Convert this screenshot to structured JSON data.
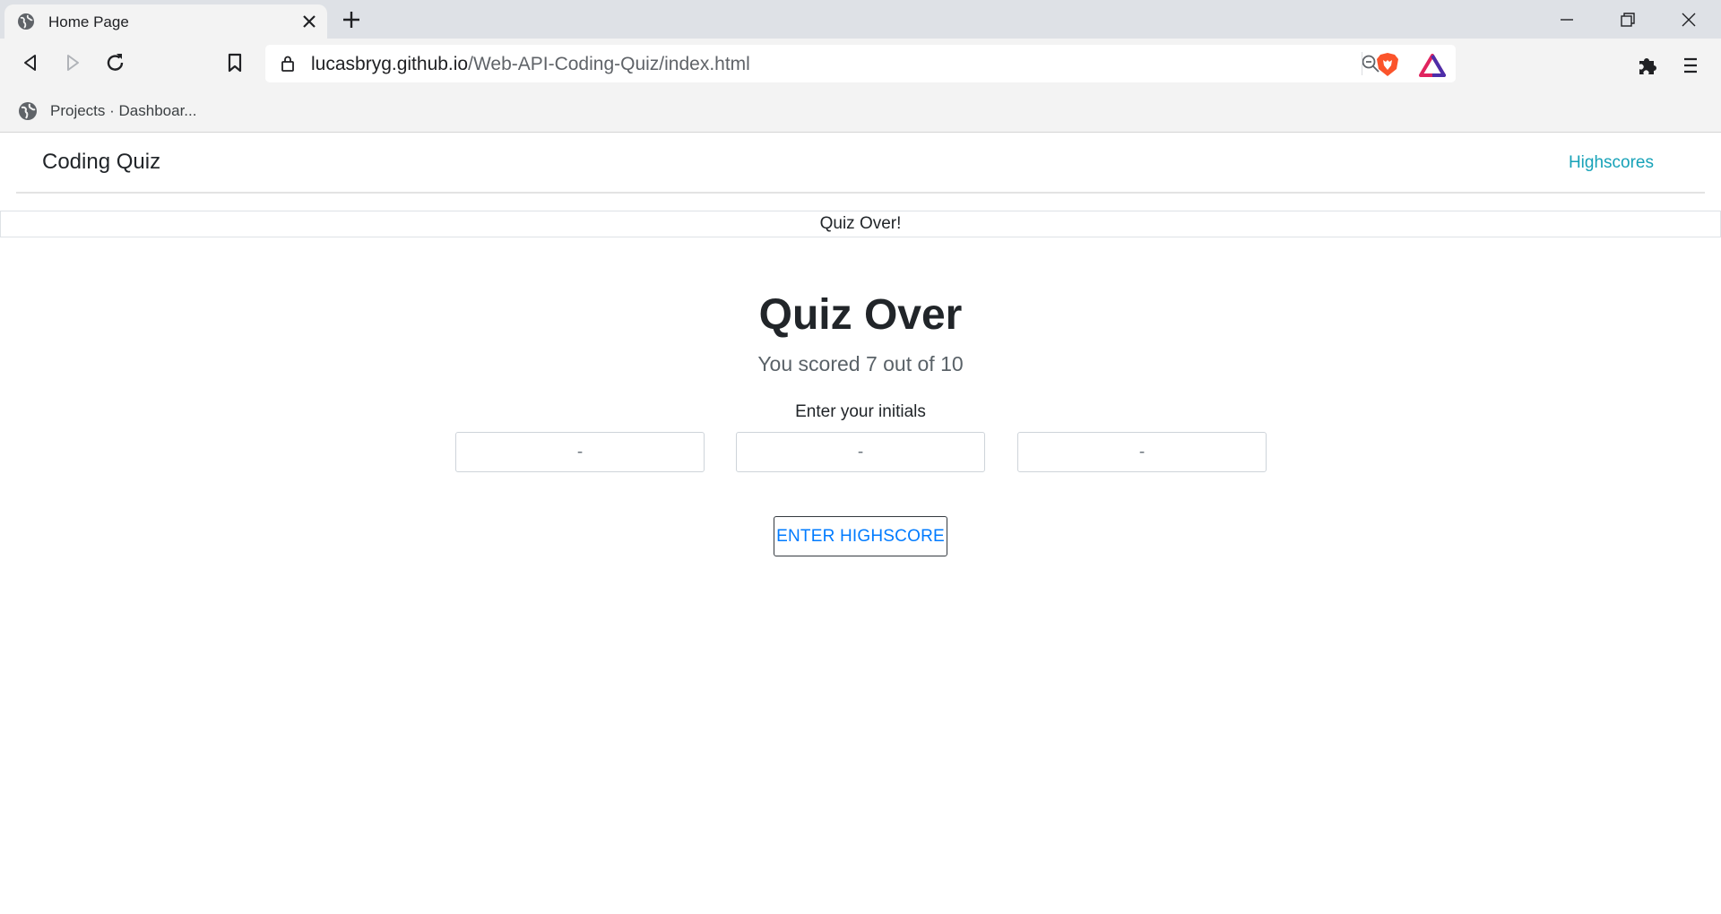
{
  "browser": {
    "tab_title": "Home Page",
    "url_host": "lucasbryg.github.io",
    "url_path": "/Web-API-Coding-Quiz/index.html",
    "bookmarks": [
      {
        "label": "Projects · Dashboar..."
      }
    ],
    "colors": {
      "brave": "#fb542b",
      "rewards_1": "#e0245e",
      "rewards_2": "#4d2ea9"
    }
  },
  "navbar": {
    "brand": "Coding Quiz",
    "link": "Highscores",
    "link_color": "#17a2b8"
  },
  "alert": {
    "text": "Quiz Over!"
  },
  "main": {
    "heading": "Quiz Over",
    "score_text": "You scored 7 out of 10",
    "initials_label": "Enter your initials",
    "initials": [
      {
        "placeholder": "-"
      },
      {
        "placeholder": "-"
      },
      {
        "placeholder": "-"
      }
    ],
    "submit_label": "ENTER HIGHSCORE",
    "submit_color": "#007bff"
  }
}
